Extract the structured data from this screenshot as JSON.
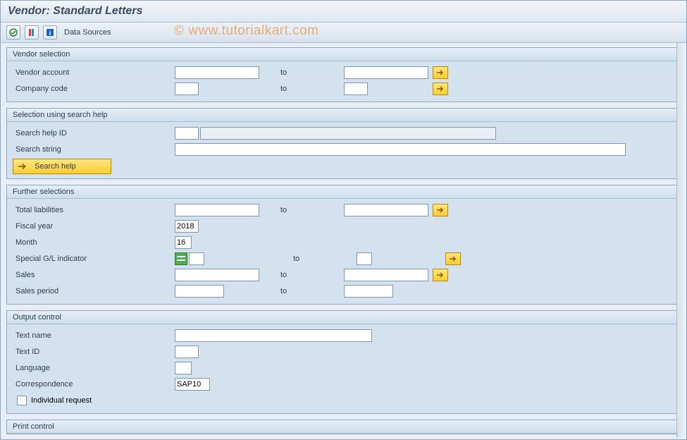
{
  "titlebar": {
    "title": "Vendor: Standard Letters"
  },
  "toolbar": {
    "data_sources": "Data Sources"
  },
  "watermark": "© www.tutorialkart.com",
  "groups": {
    "vendor_selection": {
      "title": "Vendor selection",
      "vendor_account_label": "Vendor account",
      "company_code_label": "Company code",
      "to_label": "to"
    },
    "search_help": {
      "title": "Selection using search help",
      "id_label": "Search help ID",
      "string_label": "Search string",
      "button_label": "Search help"
    },
    "further": {
      "title": "Further selections",
      "total_liab_label": "Total liabilities",
      "fiscal_year_label": "Fiscal year",
      "fiscal_year_value": "2018",
      "month_label": "Month",
      "month_value": "16",
      "sgl_label": "Special G/L indicator",
      "sales_label": "Sales",
      "sales_period_label": "Sales period",
      "to_label": "to"
    },
    "output": {
      "title": "Output control",
      "text_name_label": "Text name",
      "text_id_label": "Text ID",
      "language_label": "Language",
      "correspondence_label": "Correspondence",
      "correspondence_value": "SAP10",
      "individual_request_label": "Individual request"
    },
    "print": {
      "title": "Print control"
    }
  }
}
